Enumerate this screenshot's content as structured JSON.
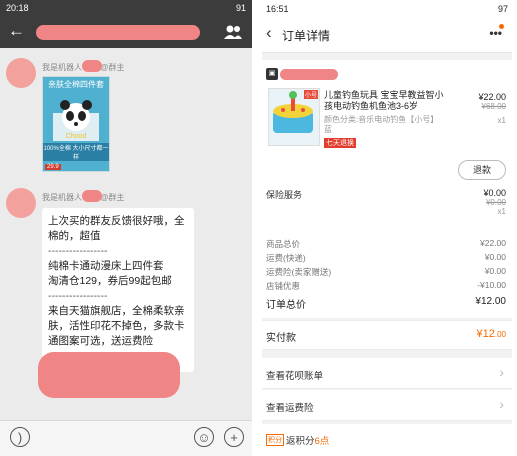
{
  "left": {
    "status_time": "20:18",
    "status_right": "91",
    "back_glyph": "←",
    "sender1": "我是机器人      有事@群主",
    "sender2": "我是机器人      有事@群主",
    "image_card": {
      "title": "亲肤全棉四件套",
      "strip": "100%全棉 大小尺寸都一样",
      "badge": "29.9"
    },
    "message_lines": [
      "上次买的群友反馈很好哦，全棉的，超值",
      "-----------------",
      "纯棉卡通动漫床上四件套",
      "淘清仓129，券后99起包邮",
      "-----------------",
      "来自天猫旗舰店，全棉柔软亲肤，活性印花不掉色，多款卡通图案可选，送运费险",
      "-----------------"
    ]
  },
  "right": {
    "status_time": "16:51",
    "status_right": "97",
    "title": "订单详情",
    "more": "•••",
    "product": {
      "name": "儿童钓鱼玩具 宝宝早教益智小孩电动钓鱼机鱼池3-6岁",
      "spec": "颜色分类:音乐电动钓鱼【小号】蓝",
      "promo": "七天退换",
      "img_tag": "小号",
      "price": "¥22.00",
      "old_price": "¥68.00",
      "qty": "x1"
    },
    "refund": "退款",
    "service": {
      "label": "保险服务",
      "price": "¥0.00",
      "old_price": "¥0.00",
      "qty": "x1"
    },
    "summary": [
      {
        "label": "商品总价",
        "value": "¥22.00"
      },
      {
        "label": "运费(快递)",
        "value": "¥0.00"
      },
      {
        "label": "运费险(卖家赠送)",
        "value": "¥0.00"
      },
      {
        "label": "店铺优惠",
        "value": "-¥10.00"
      }
    ],
    "order_total": {
      "label": "订单总价",
      "value": "¥12.00"
    },
    "paid": {
      "label": "实付款",
      "value": "¥12",
      "cents": ".00"
    },
    "links": [
      "查看花呗账单",
      "查看运费险"
    ],
    "rewards_tag": "积分",
    "rewards_text": "返积分",
    "rewards_value": "6点"
  },
  "colors": {
    "accent": "#f66a00",
    "redact": "#f08585",
    "chat_bg": "#ebebeb"
  }
}
